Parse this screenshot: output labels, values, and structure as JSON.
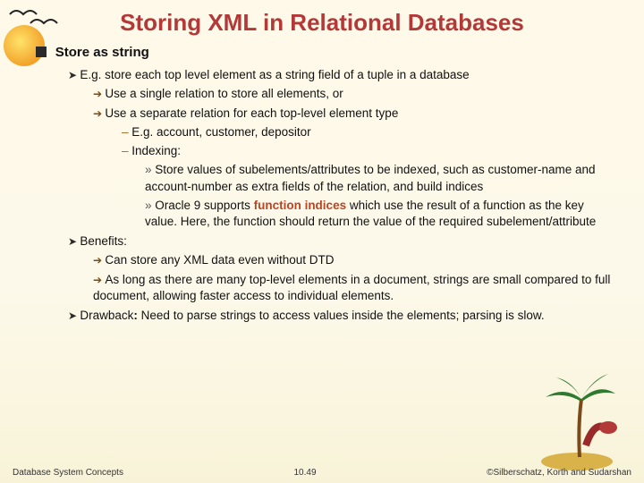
{
  "title": "Storing XML in Relational Databases",
  "l1_a": "Store as string",
  "l2_a": "E.g. store each top level element as a string field of a tuple in a database",
  "l3_a": "Use a single relation to store all elements, or",
  "l3_b": "Use a separate relation for each top-level element type",
  "l4_a": "E.g.  account, customer, depositor",
  "l4_b": "Indexing:",
  "l5_a": "Store values of subelements/attributes to be indexed, such as customer-name and account-number as extra fields of the relation, and build indices",
  "l5_b_pre": "Oracle 9 supports ",
  "l5_b_fn": "function indices",
  "l5_b_post": " which use the result of a function as the key value.  Here, the function should return the value of the required subelement/attribute",
  "l2_b": "Benefits:",
  "l3_c": "Can store any XML data even without DTD",
  "l3_d": "As long as there are many top-level elements in a document, strings are small compared to full document, allowing faster access to individual elements.",
  "l2_c_pre": "Drawback",
  "l2_c_bold": ": ",
  "l2_c_post": "Need to parse strings to access values inside the elements; parsing is slow.",
  "footer_left": "Database System Concepts",
  "footer_center": "10.49",
  "footer_right": "©Silberschatz, Korth and Sudarshan"
}
